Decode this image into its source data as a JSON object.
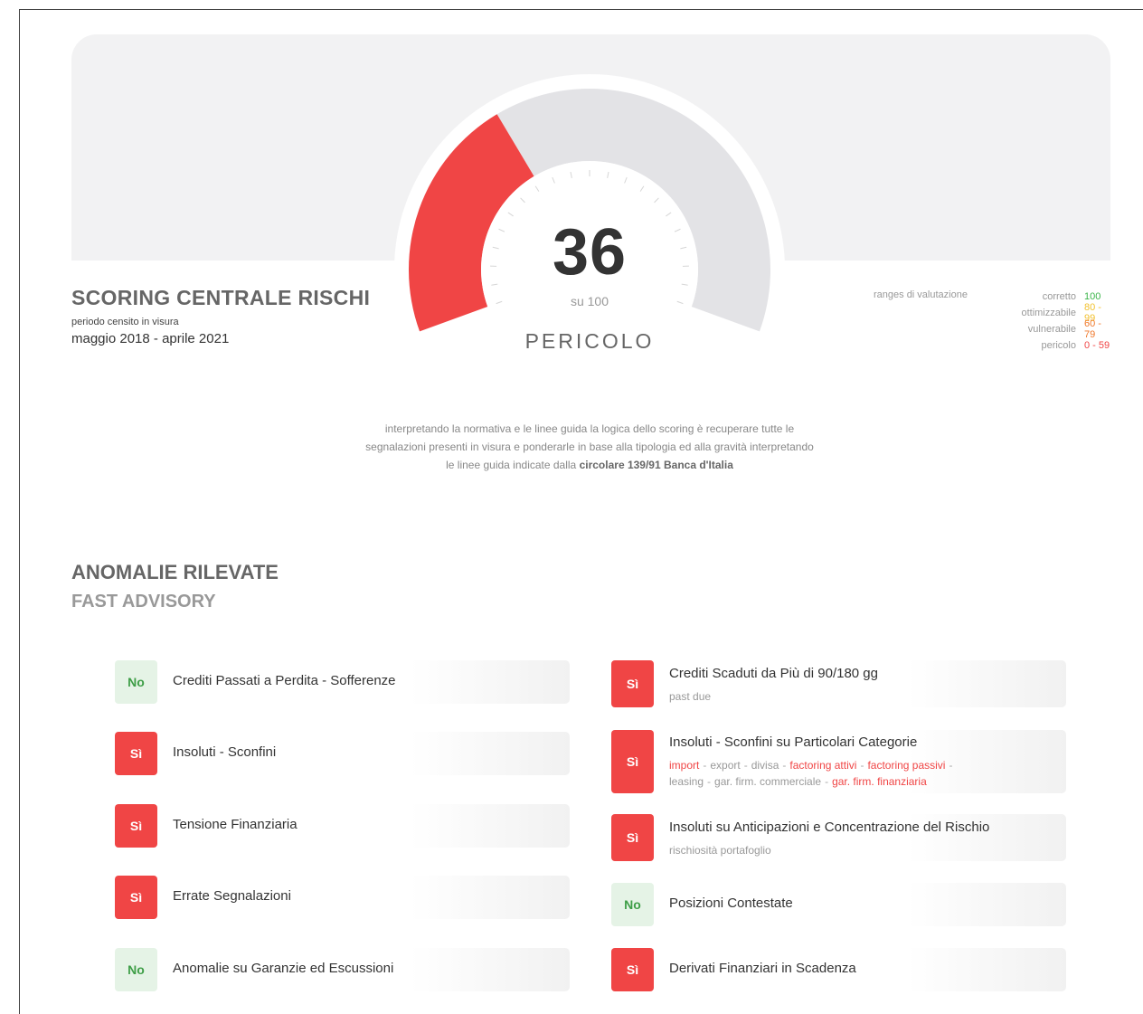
{
  "score": {
    "value": "36",
    "sub": "su 100",
    "label": "PERICOLO",
    "fraction": 0.36,
    "colors": {
      "fill": "#f04545",
      "track": "#e3e3e6"
    }
  },
  "header": {
    "title": "SCORING CENTRALE RISCHI",
    "period_caption": "periodo censito in visura",
    "period_value": "maggio 2018 - aprile 2021"
  },
  "ranges": {
    "title": "ranges di valutazione",
    "items": [
      {
        "name": "corretto",
        "value": "100",
        "color": "#3cb54a"
      },
      {
        "name": "ottimizzabile",
        "value": "80 - 99",
        "color": "#f2c12e"
      },
      {
        "name": "vulnerabile",
        "value": "60 - 79",
        "color": "#f07a2e"
      },
      {
        "name": "pericolo",
        "value": "0 - 59",
        "color": "#f04545"
      }
    ]
  },
  "note": {
    "line1": "interpretando la normativa e le linee guida la logica dello scoring è recuperare tutte le",
    "line2": "segnalazioni presenti in visura e ponderarle in base alla tipologia ed alla gravità interpretando",
    "line3_prefix": "le linee guida indicate dalla ",
    "line3_bold": "circolare 139/91 Banca d'Italia"
  },
  "anomalies": {
    "title": "ANOMALIE RILEVATE",
    "subtitle": "FAST ADVISORY",
    "left": [
      {
        "status": "No",
        "label": "Crediti Passati a Perdita - Sofferenze"
      },
      {
        "status": "Sì",
        "label": "Insoluti - Sconfini"
      },
      {
        "status": "Sì",
        "label": "Tensione Finanziaria"
      },
      {
        "status": "Sì",
        "label": "Errate Segnalazioni"
      },
      {
        "status": "No",
        "label": "Anomalie su Garanzie ed Escussioni"
      }
    ],
    "right": [
      {
        "status": "Sì",
        "label": "Crediti Scaduti da Più di 90/180 gg",
        "sub": "past due"
      },
      {
        "status": "Sì",
        "label": "Insoluti - Sconfini su Particolari Categorie",
        "tags": [
          "import",
          "export",
          "divisa",
          "factoring attivi",
          "factoring passivi",
          "leasing",
          "gar. firm. commerciale",
          "gar. firm. finanziaria"
        ],
        "tag_colors": [
          "#f04545",
          "#999999",
          "#999999",
          "#f04545",
          "#f04545",
          "#999999",
          "#999999",
          "#f04545"
        ]
      },
      {
        "status": "Sì",
        "label": "Insoluti su Anticipazioni e Concentrazione del Rischio",
        "sub": "rischiosità portafoglio"
      },
      {
        "status": "No",
        "label": "Posizioni Contestate"
      },
      {
        "status": "Sì",
        "label": "Derivati Finanziari in Scadenza"
      }
    ]
  }
}
